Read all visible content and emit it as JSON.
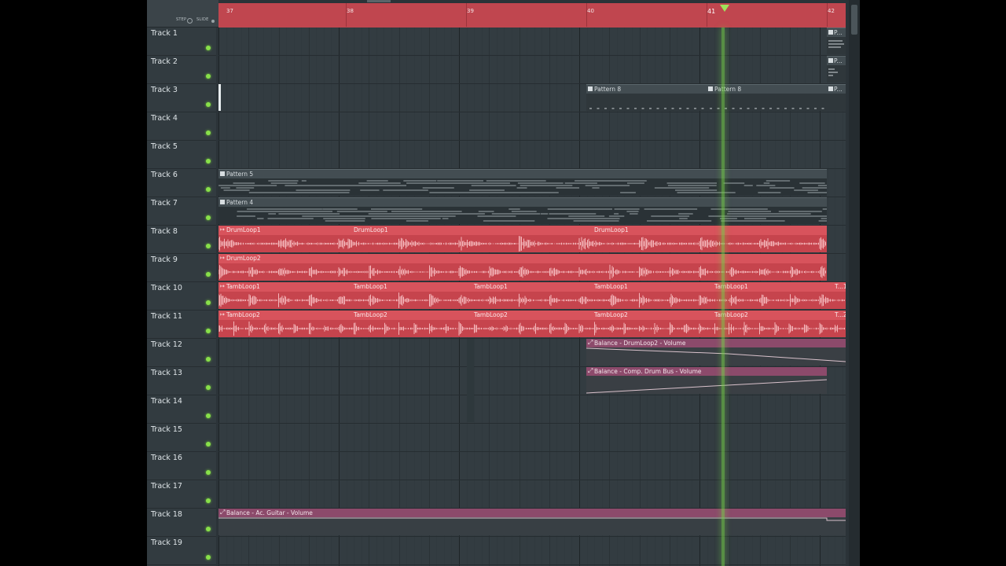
{
  "header": {
    "step_label": "STEP",
    "slide_label": "SLIDE",
    "bar_numbers": [
      "37",
      "38",
      "39",
      "40",
      "41",
      "42"
    ]
  },
  "tracks": [
    {
      "name": "Track 1"
    },
    {
      "name": "Track 2"
    },
    {
      "name": "Track 3"
    },
    {
      "name": "Track 4"
    },
    {
      "name": "Track 5"
    },
    {
      "name": "Track 6"
    },
    {
      "name": "Track 7"
    },
    {
      "name": "Track 8"
    },
    {
      "name": "Track 9"
    },
    {
      "name": "Track 10"
    },
    {
      "name": "Track 11"
    },
    {
      "name": "Track 12"
    },
    {
      "name": "Track 13"
    },
    {
      "name": "Track 14"
    },
    {
      "name": "Track 15"
    },
    {
      "name": "Track 16"
    },
    {
      "name": "Track 17"
    },
    {
      "name": "Track 18"
    },
    {
      "name": "Track 19"
    }
  ],
  "clips": {
    "t1_partial": "P...",
    "t2_partial": "P...",
    "t3_a": "Pattern 8",
    "t3_b": "Pattern 8",
    "t3_c": "P...",
    "t6": "Pattern 5",
    "t7": "Pattern 4",
    "t8_a": "DrumLoop1",
    "t8_b": "DrumLoop1",
    "t8_c": "DrumLoop1",
    "t9": "DrumLoop2",
    "t10_a": "TambLoop1",
    "t10_b": "TambLoop1",
    "t10_c": "TambLoop1",
    "t10_d": "TambLoop1",
    "t10_e": "TambLoop1",
    "t10_f": "T...1",
    "t11_a": "TambLoop2",
    "t11_b": "TambLoop2",
    "t11_c": "TambLoop2",
    "t11_d": "TambLoop2",
    "t11_e": "TambLoop2",
    "t11_f": "T...2",
    "t12": "Balance - DrumLoop2 - Volume",
    "t13": "Balance - Comp. Drum Bus - Volume",
    "t18": "Balance - Ac. Guitar - Volume"
  },
  "colors": {
    "audio_clip": "#c6444d",
    "automation_clip": "#7a3f5c",
    "pattern_clip": "#434d52",
    "playhead": "#76d248",
    "led": "#88e04a"
  }
}
